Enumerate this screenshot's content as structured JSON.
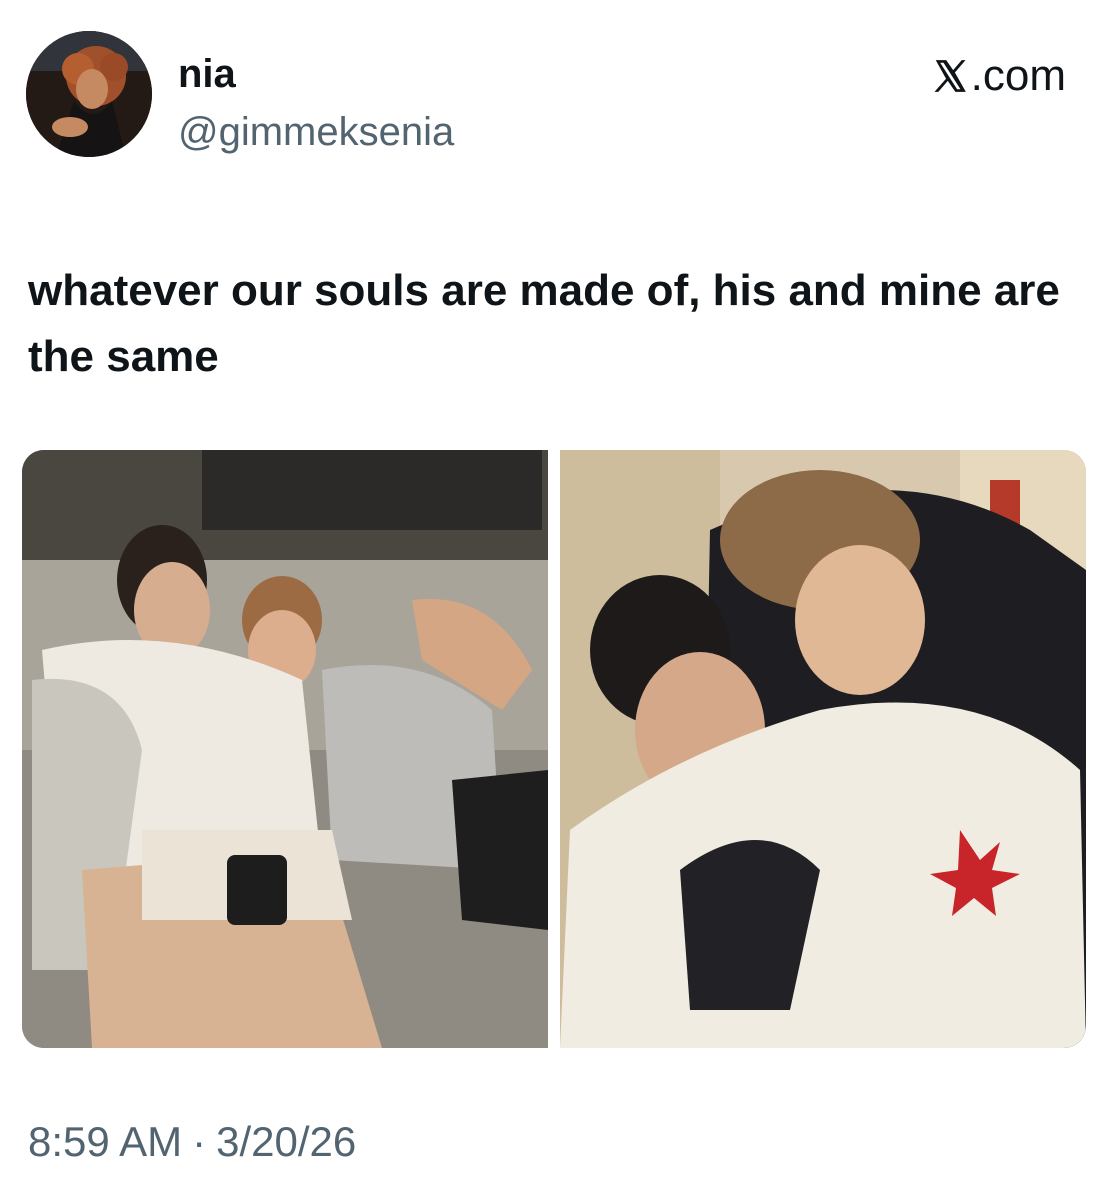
{
  "tweet": {
    "display_name": "nia",
    "handle": "@gimmeksenia",
    "brand": ".com",
    "text": "whatever our souls are made of, his and mine are the same",
    "time": "8:59 AM",
    "separator": "·",
    "date": "3/20/26"
  },
  "icons": {
    "brand_logo": "x-logo-icon",
    "avatar": "profile-avatar"
  },
  "media": [
    {
      "name": "photo-couch",
      "alt": ""
    },
    {
      "name": "photo-hug",
      "alt": ""
    }
  ],
  "colors": {
    "text_primary": "#0f1419",
    "text_secondary": "#536471",
    "background": "#ffffff"
  }
}
